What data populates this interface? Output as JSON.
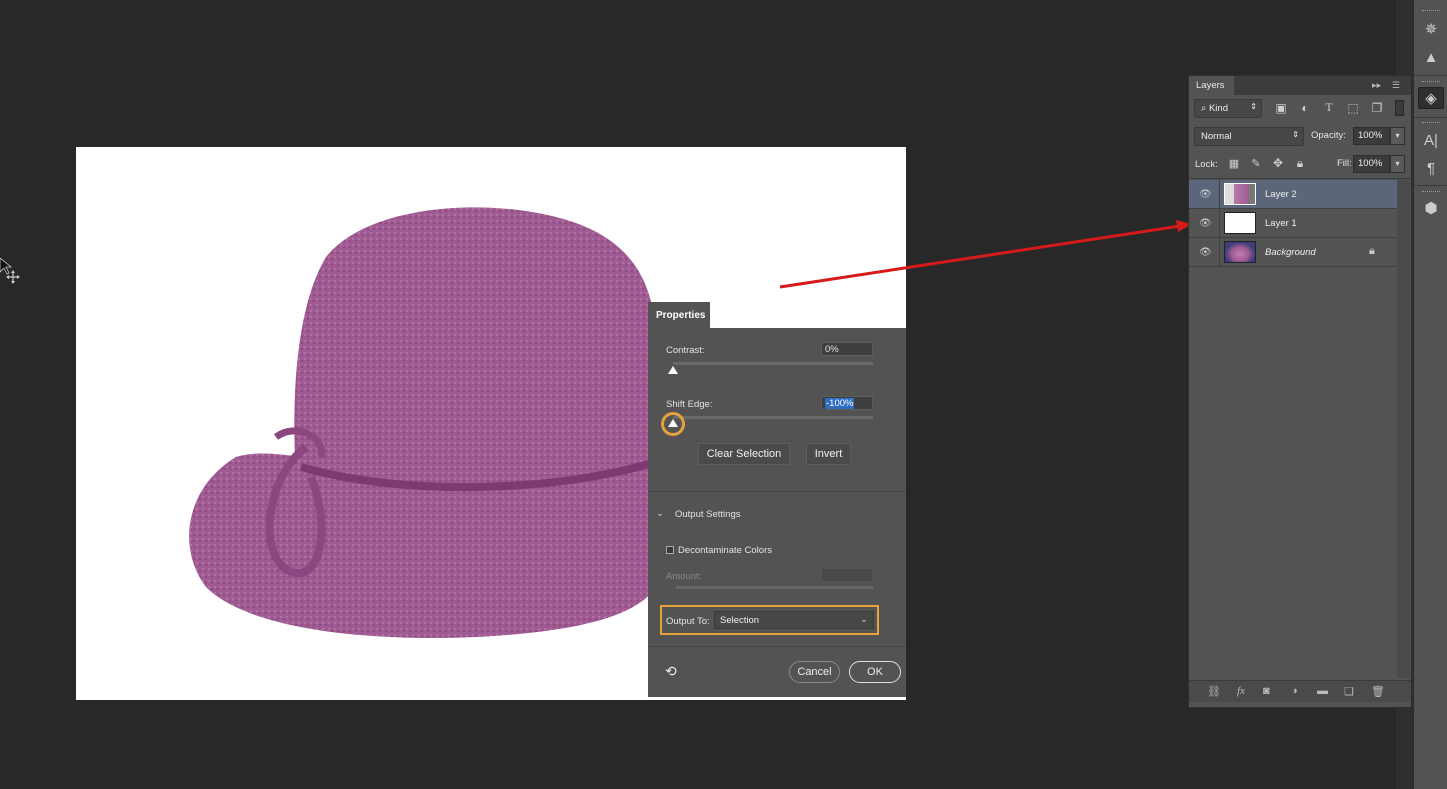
{
  "canvas": {
    "content": "purple felt hat cutout on white background"
  },
  "properties": {
    "tab_label": "Properties",
    "contrast": {
      "label": "Contrast:",
      "value": "0%",
      "slider_percent": 0
    },
    "shift_edge": {
      "label": "Shift Edge:",
      "value": "-100%",
      "slider_percent": 0,
      "highlighted": true
    },
    "clear_selection_label": "Clear Selection",
    "invert_label": "Invert",
    "output_settings_label": "Output Settings",
    "decontaminate_label": "Decontaminate Colors",
    "decontaminate_checked": false,
    "amount_label": "Amount:",
    "output_to_label": "Output To:",
    "output_to_value": "Selection",
    "cancel_label": "Cancel",
    "ok_label": "OK",
    "highlight_color": "#e7a23a"
  },
  "layers": {
    "tab_label": "Layers",
    "filter_kind": "Kind",
    "blend_mode": "Normal",
    "opacity_label": "Opacity:",
    "opacity_value": "100%",
    "lock_label": "Lock:",
    "fill_label": "Fill:",
    "fill_value": "100%",
    "items": [
      {
        "name": "Layer 2",
        "active": true,
        "visible": true,
        "locked": false
      },
      {
        "name": "Layer 1",
        "active": false,
        "visible": true,
        "locked": false
      },
      {
        "name": "Background",
        "active": false,
        "visible": true,
        "locked": true
      }
    ]
  },
  "annotation": {
    "arrow_color": "#d61a1a",
    "points_to": "Layer 1"
  },
  "right_toolbar": {
    "icons": [
      "navigator-wheel-icon",
      "histogram-icon",
      "layers-icon",
      "character-icon",
      "paragraph-icon",
      "3d-object-icon"
    ]
  }
}
